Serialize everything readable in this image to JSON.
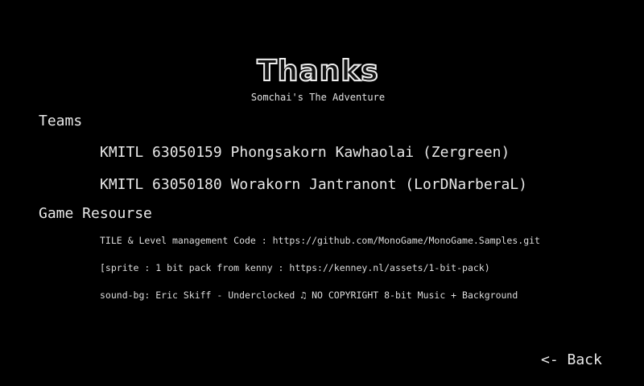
{
  "title": "Thanks",
  "subtitle": "Somchai's The Adventure",
  "teams": {
    "heading": "Teams",
    "members": [
      "KMITL 63050159 Phongsakorn Kawhaolai (Zergreen)",
      "KMITL 63050180 Worakorn Jantranont (LorDNarberaL)"
    ]
  },
  "resources": {
    "heading": "Game Resourse",
    "credits": [
      "TILE & Level management Code : https://github.com/MonoGame/MonoGame.Samples.git",
      "[sprite : 1 bit pack from kenny : https://kenney.nl/assets/1-bit-pack)",
      "sound-bg: Eric Skiff - Underclocked ♫ NO COPYRIGHT 8-bit Music + Background"
    ]
  },
  "back_label": "<- Back"
}
